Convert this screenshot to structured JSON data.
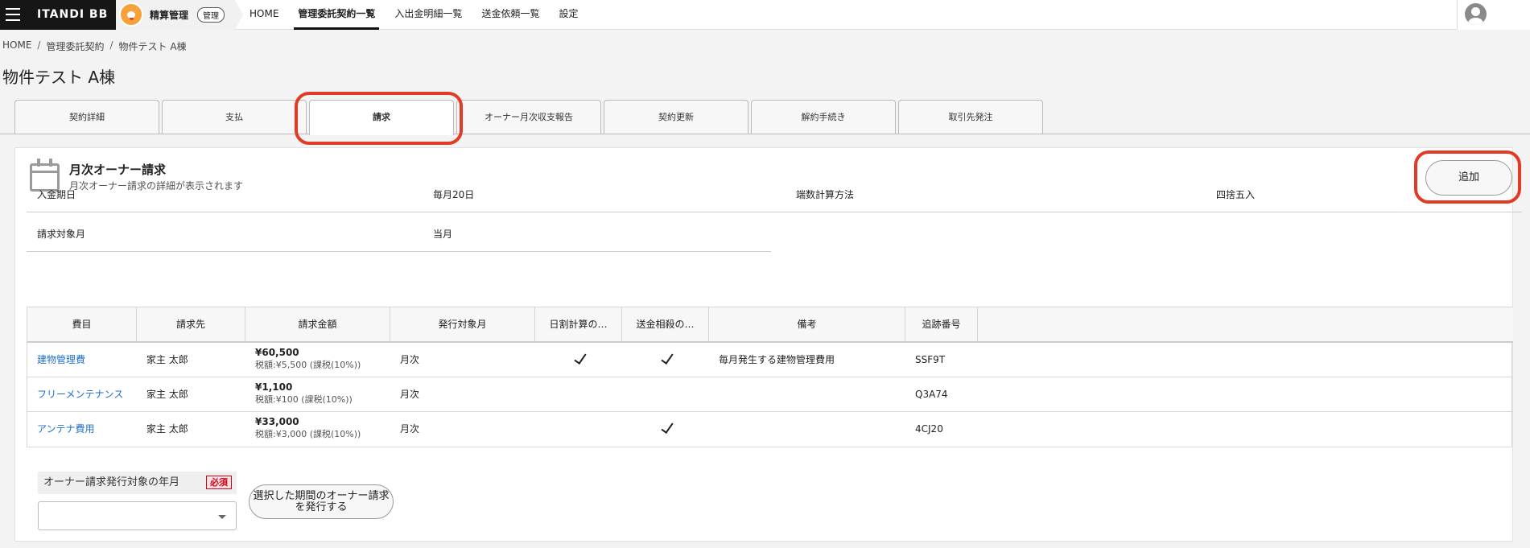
{
  "topbar": {
    "brand": "ITANDI BB",
    "app_name": "精算管理",
    "app_badge": "管理",
    "nav": [
      "HOME",
      "管理委託契約一覧",
      "入出金明細一覧",
      "送金依頼一覧",
      "設定"
    ]
  },
  "breadcrumb": [
    "HOME",
    "管理委託契約",
    "物件テスト A棟"
  ],
  "page_title": "物件テスト A棟",
  "tabs": [
    "契約詳細",
    "支払",
    "請求",
    "オーナー月次収支報告",
    "契約更新",
    "解約手続き",
    "取引先発注"
  ],
  "section": {
    "title": "月次オーナー請求",
    "description": "月次オーナー請求の詳細が表示されます",
    "add_label": "追加"
  },
  "info": {
    "payment_due_label": "入金期日",
    "payment_due_value": "毎月20日",
    "rounding_label": "端数計算方法",
    "rounding_value": "四捨五入",
    "target_month_label": "請求対象月",
    "target_month_value": "当月"
  },
  "table": {
    "headers": [
      "費目",
      "請求先",
      "請求金額",
      "発行対象月",
      "日割計算の…",
      "送金相殺の…",
      "備考",
      "追跡番号"
    ],
    "rows": [
      {
        "item": "建物管理費",
        "payer": "家主 太郎",
        "amount": "¥60,500",
        "tax": "税額:¥5,500 (課税(10%))",
        "month": "月次",
        "prorate": true,
        "offset": true,
        "note": "毎月発生する建物管理費用",
        "tracking": "SSF9T"
      },
      {
        "item": "フリーメンテナンス",
        "payer": "家主 太郎",
        "amount": "¥1,100",
        "tax": "税額:¥100 (課税(10%))",
        "month": "月次",
        "prorate": false,
        "offset": false,
        "note": "",
        "tracking": "Q3A74"
      },
      {
        "item": "アンテナ費用",
        "payer": "家主 太郎",
        "amount": "¥33,000",
        "tax": "税額:¥3,000 (課税(10%))",
        "month": "月次",
        "prorate": false,
        "offset": true,
        "note": "",
        "tracking": "4CJ20"
      }
    ]
  },
  "issue_form": {
    "label": "オーナー請求発行対象の年月",
    "required": "必須",
    "select_value": "",
    "button_label": "選択した期間のオーナー請求を発行する"
  },
  "colors": {
    "highlight": "#e13a25",
    "link": "#1e6fc7"
  }
}
